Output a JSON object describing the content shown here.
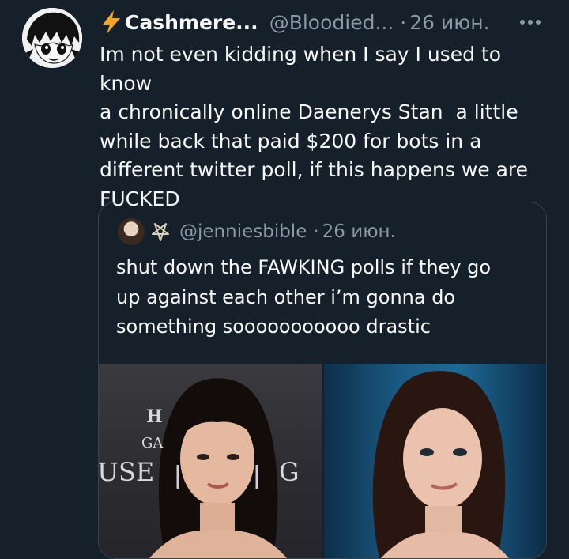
{
  "tweet": {
    "display_name": "Cashmere...",
    "handle": "@Bloodied...",
    "separator": "·",
    "date": "26 июн.",
    "text": "Im not even kidding when I say I used to know\na chronically online Daenerys Stan  a little\nwhile back that paid $200 for bots in a\ndifferent twitter poll, if this happens we are\nFUCKED",
    "icons": {
      "name_prefix": "lightning-bolt-icon",
      "more": "more-options-icon"
    },
    "colors": {
      "background": "#15202b",
      "text": "#f7f9f9",
      "secondary_text": "#8b98a5",
      "bolt": "#f6a623"
    }
  },
  "quoted_tweet": {
    "handle": "@jenniesbible",
    "separator": "·",
    "date": "26 июн.",
    "text": "shut down the FAWKING polls if they go\nup against each other i’m gonna do\nsomething sooooooooooo drastic",
    "icons": {
      "name_prefix": "pentagram-icon"
    },
    "images": {
      "left": {
        "backdrop_text": [
          "H",
          "GA",
          "USE",
          "G"
        ]
      },
      "right": {}
    }
  }
}
